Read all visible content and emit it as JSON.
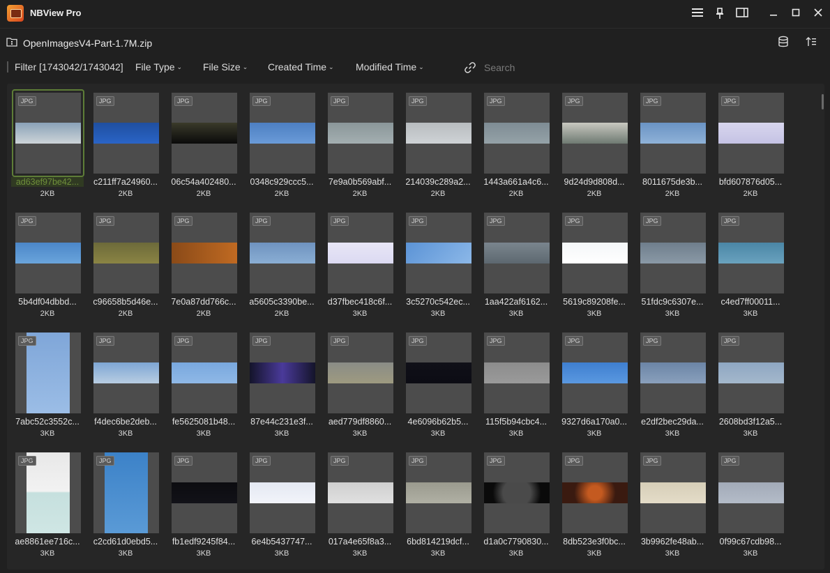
{
  "app": {
    "title": "NBView Pro"
  },
  "path": {
    "archive_name": "OpenImagesV4-Part-1.7M.zip"
  },
  "filters": {
    "summary": "Filter [1743042/1743042]",
    "file_type": "File Type",
    "file_size": "File Size",
    "created_time": "Created Time",
    "modified_time": "Modified Time",
    "search_placeholder": "Search"
  },
  "badge_label": "JPG",
  "colors": {
    "selection": "#5e7d37",
    "background": "#202020",
    "thumb_bg": "#4c4c4c"
  },
  "files": [
    {
      "name": "ad63ef97be42...",
      "size": "2KB",
      "selected": true,
      "photo": "linear-gradient(#8aa2b8,#cdd4d8)"
    },
    {
      "name": "c211ff7a24960...",
      "size": "2KB",
      "photo": "linear-gradient(#1f4fa0,#2a64c6)"
    },
    {
      "name": "06c54a402480...",
      "size": "2KB",
      "photo": "linear-gradient(#3a3a2a,#0a0a0a)"
    },
    {
      "name": "0348c929ccc5...",
      "size": "2KB",
      "photo": "linear-gradient(#4d7fc2,#6a9bd8)"
    },
    {
      "name": "7e9a0b569abf...",
      "size": "2KB",
      "photo": "linear-gradient(#8a9699,#a4afb1)"
    },
    {
      "name": "214039c289a2...",
      "size": "2KB",
      "photo": "linear-gradient(#b8bcbf,#cfd3d6)"
    },
    {
      "name": "1443a661a4c6...",
      "size": "2KB",
      "photo": "linear-gradient(#7e8c94,#95a2a8)"
    },
    {
      "name": "9d24d9d808d...",
      "size": "2KB",
      "photo": "linear-gradient(#c8c8c0,#6e7a72)"
    },
    {
      "name": "8011675de3b...",
      "size": "2KB",
      "photo": "linear-gradient(#6a93c4,#8fb2d8)"
    },
    {
      "name": "bfd607876d05...",
      "size": "2KB",
      "photo": "linear-gradient(#d8d6ee,#c4c2e4)"
    },
    {
      "name": "5b4df04dbbd...",
      "size": "2KB",
      "photo": "linear-gradient(#4b86c8,#6aa4dc)"
    },
    {
      "name": "c96658b5d46e...",
      "size": "2KB",
      "photo": "linear-gradient(#6c6a3a,#8a8444)"
    },
    {
      "name": "7e0a87dd766c...",
      "size": "2KB",
      "photo": "linear-gradient(90deg,#8a4a18,#c06a22)"
    },
    {
      "name": "a5605c3390be...",
      "size": "2KB",
      "photo": "linear-gradient(#6f93bf,#8aaed4)"
    },
    {
      "name": "d37fbec418c6f...",
      "size": "3KB",
      "photo": "linear-gradient(#e8e6f6,#dcdaf2)"
    },
    {
      "name": "3c5270c542ec...",
      "size": "3KB",
      "photo": "linear-gradient(135deg,#5b93d6,#8cb8e8)"
    },
    {
      "name": "1aa422af6162...",
      "size": "3KB",
      "photo": "linear-gradient(#7a858e,#5d6870)"
    },
    {
      "name": "5619c89208fe...",
      "size": "3KB",
      "photo": "linear-gradient(#f4f6f8,#ffffff)"
    },
    {
      "name": "51fdc9c6307e...",
      "size": "3KB",
      "photo": "linear-gradient(#6f7e8c,#8a99a6)"
    },
    {
      "name": "c4ed7ff00011...",
      "size": "3KB",
      "photo": "linear-gradient(#4a86a6,#6aa2be)"
    },
    {
      "name": "7abc52c3552c...",
      "size": "3KB",
      "tall": true,
      "photo": "linear-gradient(#7fa6d8,#9bbde6)"
    },
    {
      "name": "f4dec6be2deb...",
      "size": "3KB",
      "photo": "linear-gradient(#7ea6d4,#b8cde2)"
    },
    {
      "name": "fe5625081b48...",
      "size": "3KB",
      "photo": "linear-gradient(#79a8de,#8fb8e6)"
    },
    {
      "name": "87e44c231e3f...",
      "size": "3KB",
      "photo": "linear-gradient(90deg,#14142a,#4a3a9a,#14142a)"
    },
    {
      "name": "aed779df8860...",
      "size": "3KB",
      "photo": "linear-gradient(#8a8c86,#9e9a80)"
    },
    {
      "name": "4e6096b62b5...",
      "size": "3KB",
      "photo": "linear-gradient(#101018,#0c0c14)"
    },
    {
      "name": "115f5b94cbc4...",
      "size": "3KB",
      "photo": "linear-gradient(#8c8c8c,#9a9a9a)"
    },
    {
      "name": "9327d6a170a0...",
      "size": "3KB",
      "photo": "linear-gradient(#3f7fd0,#5a98e0)"
    },
    {
      "name": "e2df2bec29da...",
      "size": "3KB",
      "photo": "linear-gradient(#6b85a6,#8aa0bc)"
    },
    {
      "name": "2608bd3f12a5...",
      "size": "3KB",
      "photo": "linear-gradient(#8ea6c2,#a4b8cc)"
    },
    {
      "name": "ae8861ee716c...",
      "size": "3KB",
      "tall": true,
      "photo": "linear-gradient(#e8e8e8 0,#f2f2f2 48%,#c6e0de 50%,#cfe6e4 100%)"
    },
    {
      "name": "c2cd61d0ebd5...",
      "size": "3KB",
      "tall": true,
      "photo": "linear-gradient(#3c82c8,#5a9ad6)"
    },
    {
      "name": "fb1edf9245f84...",
      "size": "3KB",
      "photo": "linear-gradient(#0c0c10,#121218)"
    },
    {
      "name": "6e4b5437747...",
      "size": "3KB",
      "photo": "linear-gradient(#e4e8f2,#f2f4fa)"
    },
    {
      "name": "017a4e65f8a3...",
      "size": "3KB",
      "photo": "linear-gradient(#cfcfcf,#e0e0e0)"
    },
    {
      "name": "6bd814219dcf...",
      "size": "3KB",
      "photo": "linear-gradient(#9a9a8e,#b0b0a4)"
    },
    {
      "name": "d1a0c7790830...",
      "size": "3KB",
      "photo": "radial-gradient(circle,#4a4a4a 40%,#0a0a0a 70%)"
    },
    {
      "name": "8db523e3f0bc...",
      "size": "3KB",
      "photo": "radial-gradient(circle,#c45a20 20%,#3a1a10 60%)"
    },
    {
      "name": "3b9962fe48ab...",
      "size": "3KB",
      "photo": "linear-gradient(#d6ceb8,#e4dcc8)"
    },
    {
      "name": "0f99c67cdb98...",
      "size": "3KB",
      "photo": "linear-gradient(#a2aab8,#b4bcc8)"
    }
  ]
}
